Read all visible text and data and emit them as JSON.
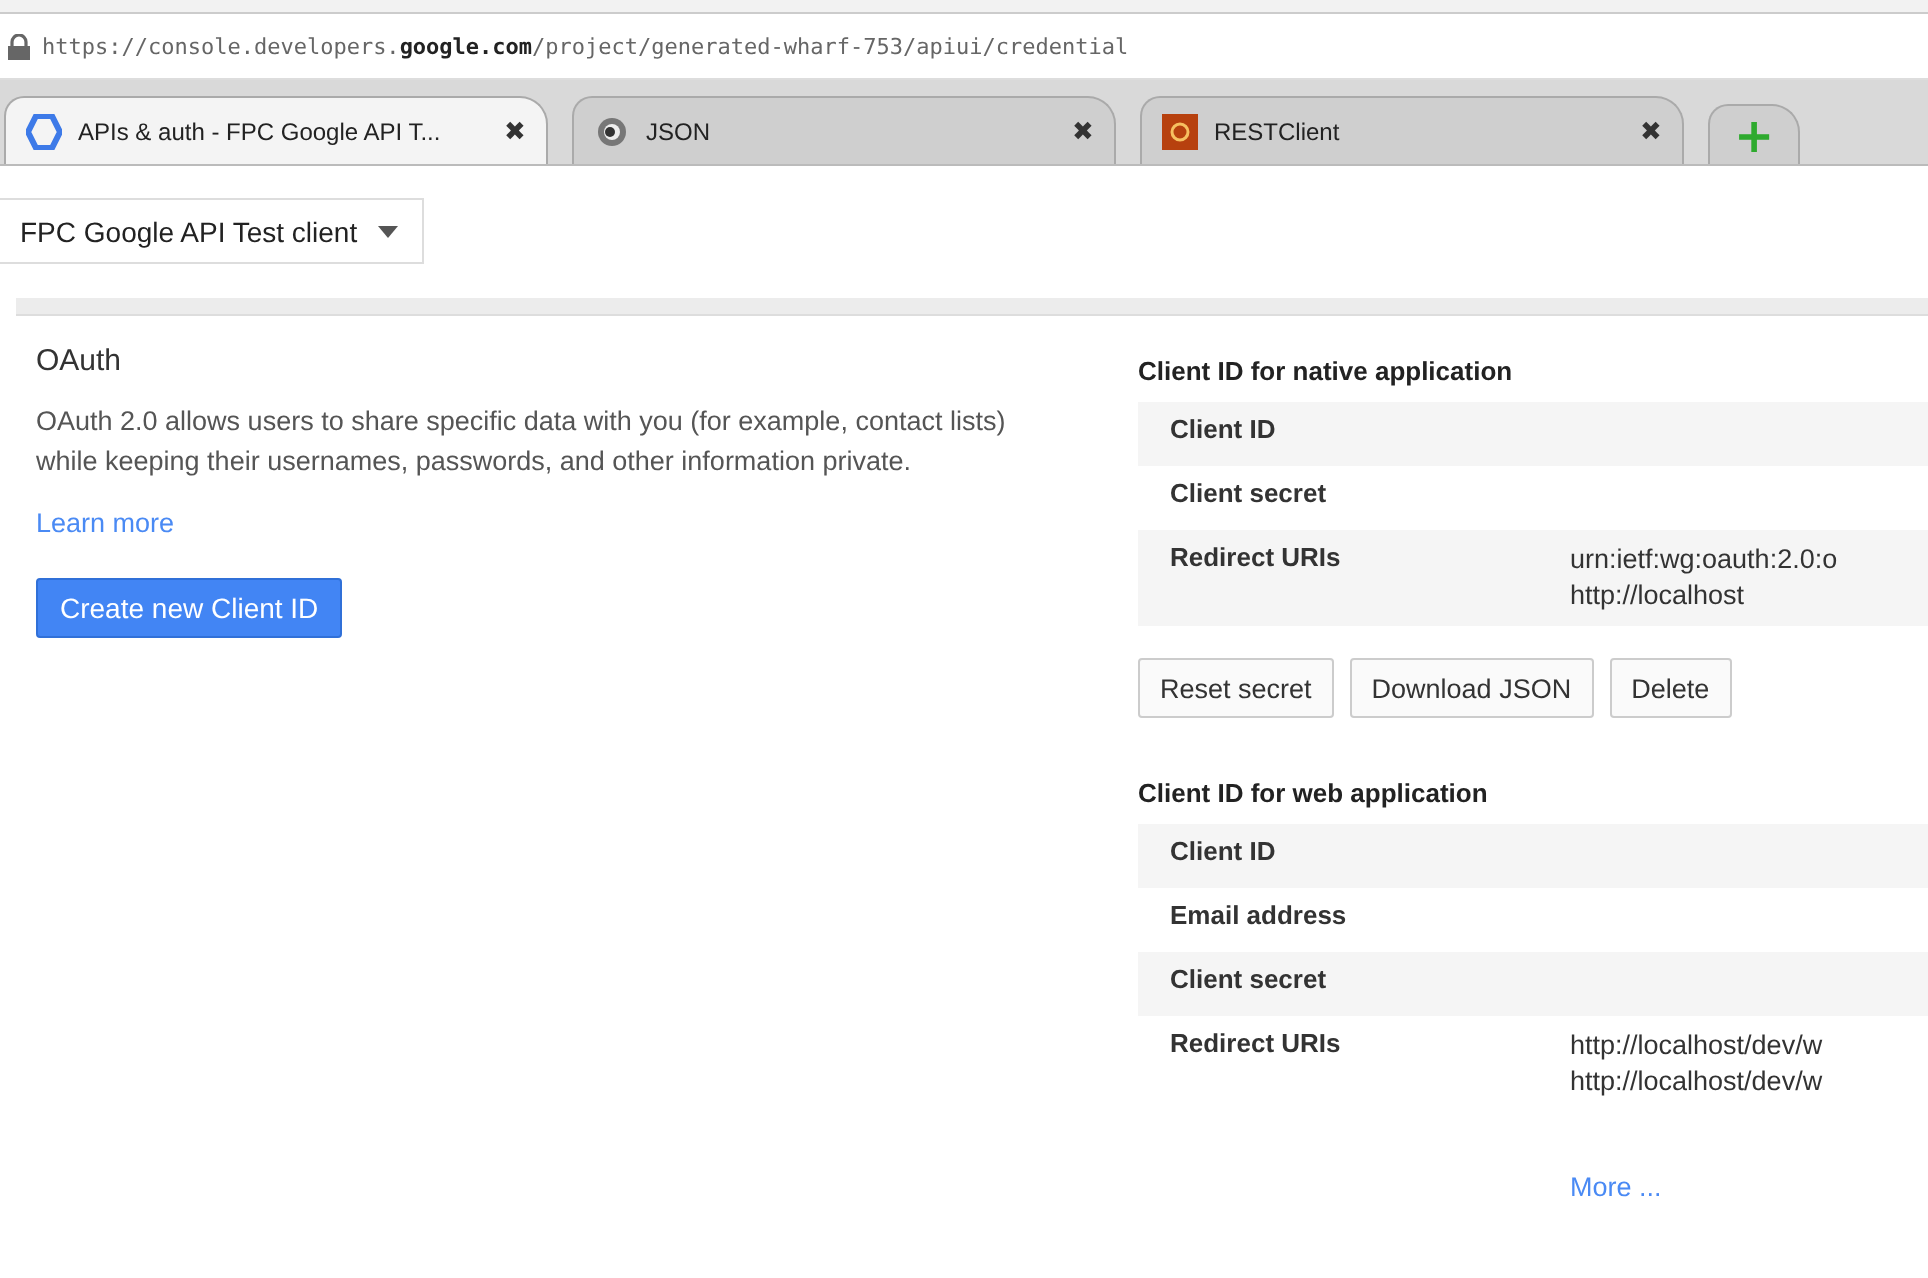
{
  "address_bar": {
    "url_prefix": "https://console.developers.",
    "url_domain": "google.com",
    "url_path": "/project/generated-wharf-753/apiui/credential"
  },
  "tabs": [
    {
      "label": "APIs & auth - FPC Google API T...",
      "close": "✖",
      "selected": true,
      "kind": "hexagon"
    },
    {
      "label": "JSON",
      "close": "✖",
      "selected": false,
      "kind": "ring"
    },
    {
      "label": "RESTClient",
      "close": "✖",
      "selected": false,
      "kind": "square"
    }
  ],
  "new_tab": {
    "label": "+"
  },
  "project_select": {
    "value": "FPC Google API Test client"
  },
  "oauth": {
    "title": "OAuth",
    "description": "OAuth 2.0 allows users to share specific data with you (for example, contact lists) while keeping their usernames, passwords, and other information private.",
    "learn_more": "Learn more",
    "create_button": "Create new Client ID"
  },
  "client_sections": [
    {
      "title": "Client ID for native application",
      "rows": [
        {
          "label": "Client ID",
          "values": []
        },
        {
          "label": "Client secret",
          "values": []
        },
        {
          "label": "Redirect URIs",
          "values": [
            "urn:ietf:wg:oauth:2.0:o",
            "http://localhost"
          ]
        }
      ],
      "buttons": [
        "Reset secret",
        "Download JSON",
        "Delete"
      ]
    },
    {
      "title": "Client ID for web application",
      "rows": [
        {
          "label": "Client ID",
          "values": []
        },
        {
          "label": "Email address",
          "values": []
        },
        {
          "label": "Client secret",
          "values": []
        },
        {
          "label": "Redirect URIs",
          "values": [
            "http://localhost/dev/w",
            "http://localhost/dev/w"
          ]
        }
      ],
      "more": "More ..."
    }
  ]
}
